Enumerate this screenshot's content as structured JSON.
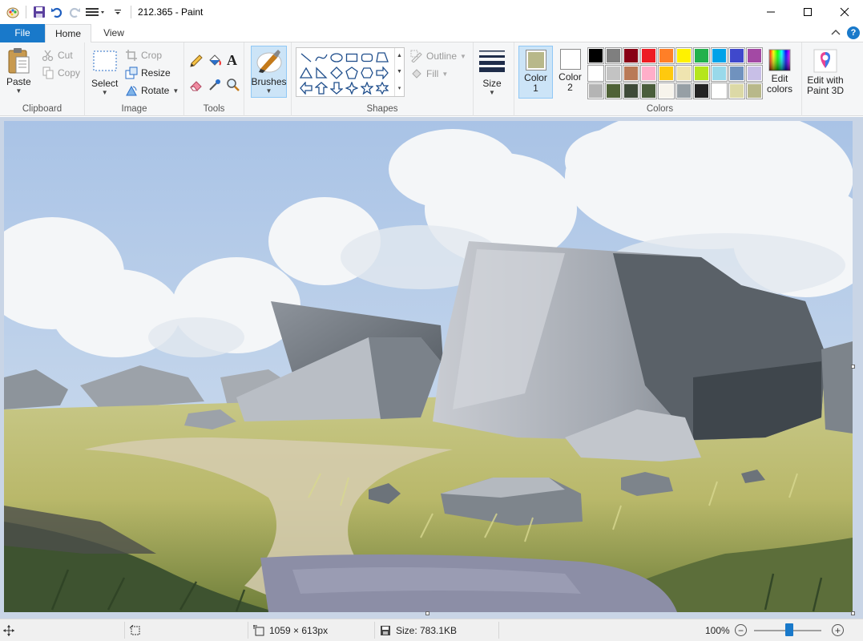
{
  "window": {
    "title": "212.365 - Paint"
  },
  "tabs": {
    "file": "File",
    "home": "Home",
    "view": "View"
  },
  "clipboard": {
    "paste": "Paste",
    "cut": "Cut",
    "copy": "Copy",
    "group": "Clipboard"
  },
  "image": {
    "select": "Select",
    "crop": "Crop",
    "resize": "Resize",
    "rotate": "Rotate",
    "group": "Image"
  },
  "tools": {
    "group": "Tools"
  },
  "brushes": {
    "label": "Brushes"
  },
  "shapes": {
    "outline": "Outline",
    "fill": "Fill",
    "group": "Shapes"
  },
  "size": {
    "label": "Size"
  },
  "colors": {
    "color1_label": "Color",
    "color1_num": "1",
    "color2_label": "Color",
    "color2_num": "2",
    "color1_value": "#b8b88a",
    "color2_value": "#ffffff",
    "edit_colors_line1": "Edit",
    "edit_colors_line2": "colors",
    "edit_paint3d_line1": "Edit with",
    "edit_paint3d_line2": "Paint 3D",
    "group": "Colors",
    "palette": [
      "#000000",
      "#7f7f7f",
      "#880015",
      "#ed1c24",
      "#ff7f27",
      "#fff200",
      "#22b14c",
      "#00a2e8",
      "#3f48cc",
      "#a349a4",
      "#ffffff",
      "#c3c3c3",
      "#b97a57",
      "#ffaec9",
      "#ffc90e",
      "#efe4b0",
      "#b5e61d",
      "#99d9ea",
      "#7092be",
      "#c8bfe7",
      "#b4b4b4",
      "#4f6237",
      "#3e4a38",
      "#4a5e3c",
      "#f7f4ec",
      "#969fa5",
      "#242424",
      "#ffffff",
      "#dcd9a6",
      "#b8b88a"
    ]
  },
  "status": {
    "dimensions": "1059 × 613px",
    "size": "Size: 783.1KB",
    "zoom": "100%",
    "zoom_level": 100
  }
}
